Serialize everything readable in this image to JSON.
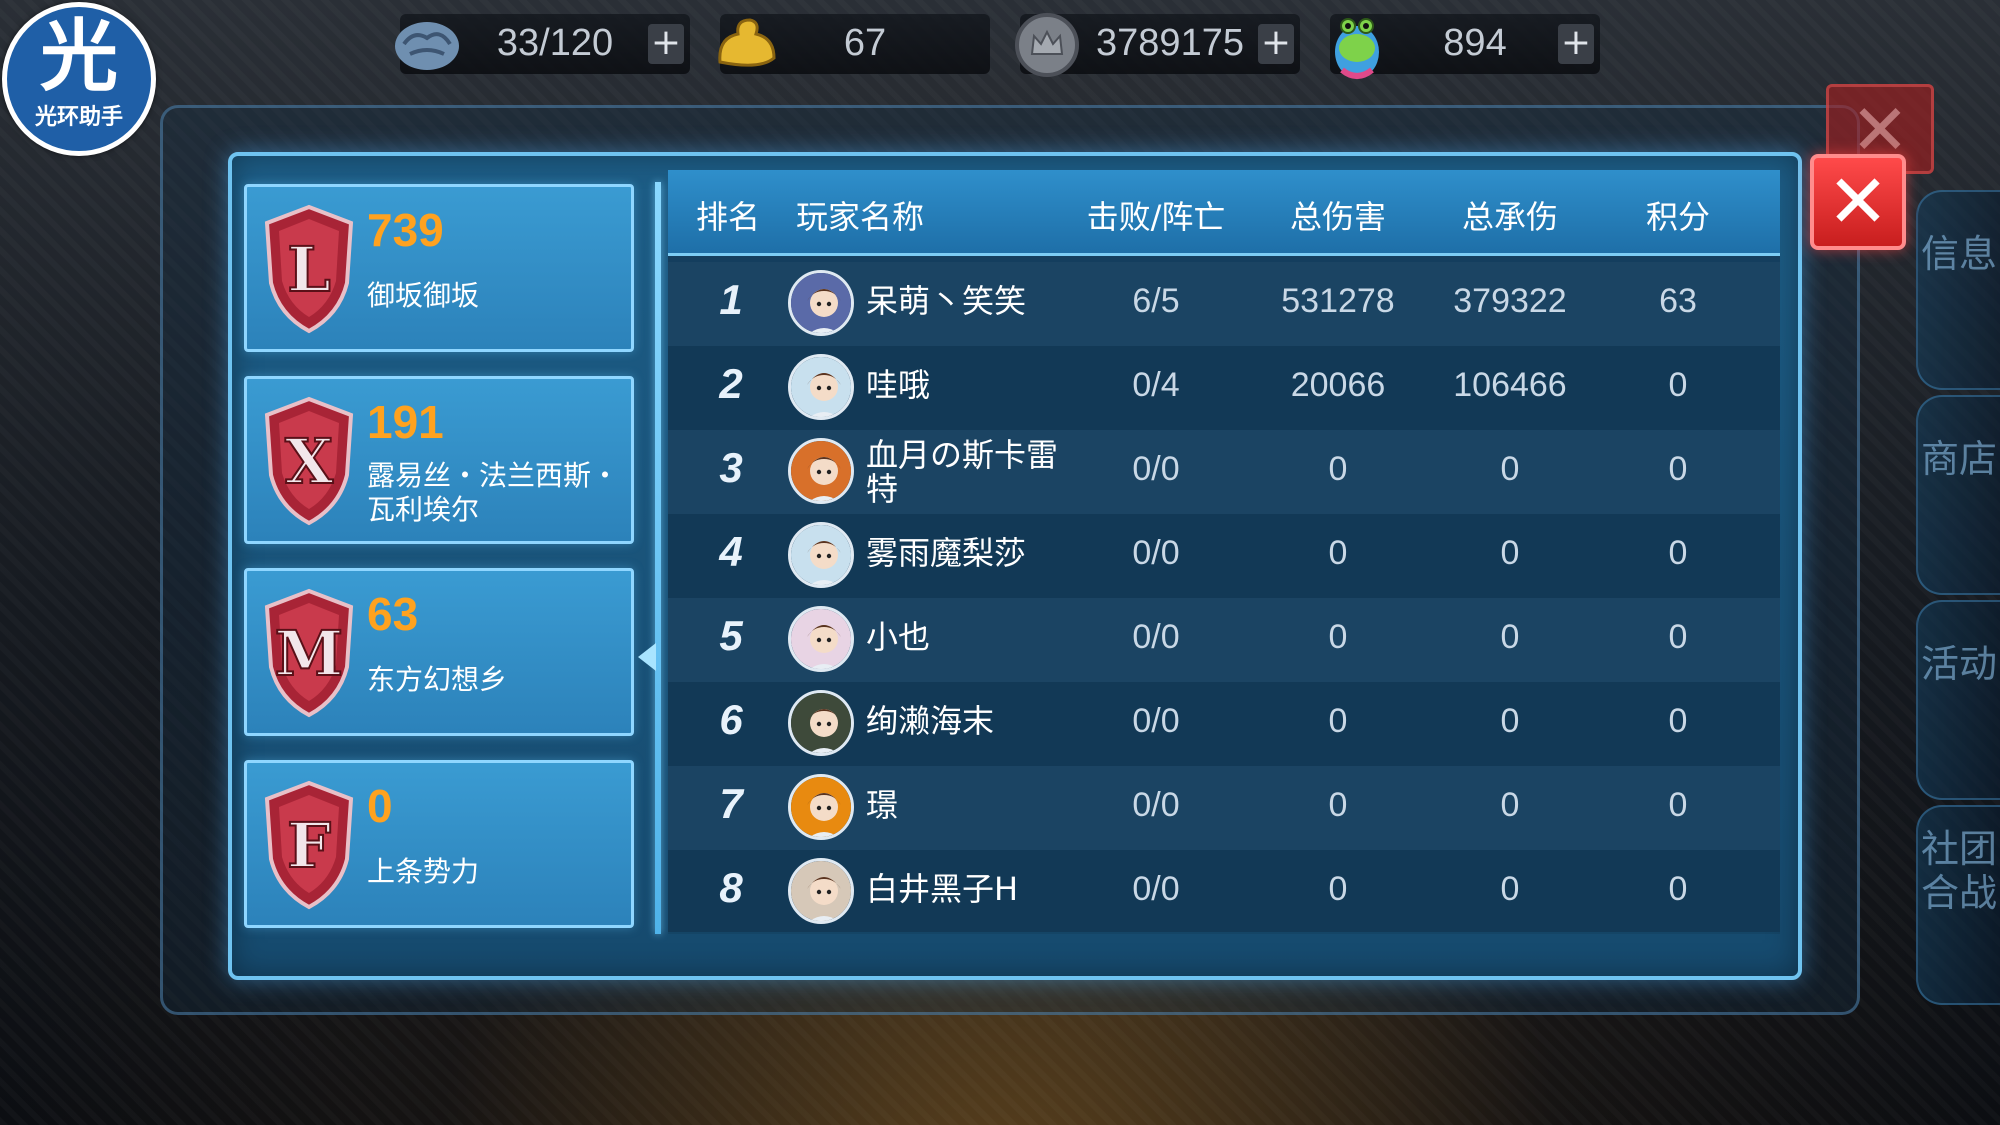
{
  "logo": {
    "glyph": "光",
    "text": "光环助手"
  },
  "resources": [
    {
      "icon": "brain-icon",
      "value": "33/120",
      "plus": "+"
    },
    {
      "icon": "muscle-icon",
      "value": "67"
    },
    {
      "icon": "crown-coin-icon",
      "value": "3789175",
      "plus": "+"
    },
    {
      "icon": "frog-gem-icon",
      "value": "894",
      "plus": "+"
    }
  ],
  "side_tabs": [
    "信息",
    "商店",
    "活动",
    "社团合战"
  ],
  "close_label": "✕",
  "teams": [
    {
      "letter": "L",
      "score": "739",
      "name": "御坂御坂",
      "color": "#b0283a"
    },
    {
      "letter": "X",
      "score": "191",
      "name": "露易丝・法兰西斯・瓦利埃尔",
      "color": "#b0283a"
    },
    {
      "letter": "M",
      "score": "63",
      "name": "东方幻想乡",
      "color": "#b0283a"
    },
    {
      "letter": "F",
      "score": "0",
      "name": "上条势力",
      "color": "#b0283a"
    }
  ],
  "table": {
    "headers": {
      "rank": "排名",
      "player": "玩家名称",
      "kd": "击败/阵亡",
      "damage": "总伤害",
      "taken": "总承伤",
      "points": "积分"
    },
    "rows": [
      {
        "rank": "1",
        "player": "呆萌丶笑笑",
        "kd": "6/5",
        "damage": "531278",
        "taken": "379322",
        "points": "63",
        "avatar_color": "#5a6aa8"
      },
      {
        "rank": "2",
        "player": "哇哦",
        "kd": "0/4",
        "damage": "20066",
        "taken": "106466",
        "points": "0",
        "avatar_color": "#c8e0ee"
      },
      {
        "rank": "3",
        "player": "血月の斯卡雷特",
        "kd": "0/0",
        "damage": "0",
        "taken": "0",
        "points": "0",
        "avatar_color": "#d8702a"
      },
      {
        "rank": "4",
        "player": "雾雨魔梨莎",
        "kd": "0/0",
        "damage": "0",
        "taken": "0",
        "points": "0",
        "avatar_color": "#c8e0ee"
      },
      {
        "rank": "5",
        "player": "小也",
        "kd": "0/0",
        "damage": "0",
        "taken": "0",
        "points": "0",
        "avatar_color": "#e8d4e4"
      },
      {
        "rank": "6",
        "player": "绚濑海末",
        "kd": "0/0",
        "damage": "0",
        "taken": "0",
        "points": "0",
        "avatar_color": "#3e4a3a"
      },
      {
        "rank": "7",
        "player": "璟",
        "kd": "0/0",
        "damage": "0",
        "taken": "0",
        "points": "0",
        "avatar_color": "#e88a10"
      },
      {
        "rank": "8",
        "player": "白井黑子H",
        "kd": "0/0",
        "damage": "0",
        "taken": "0",
        "points": "0",
        "avatar_color": "#d6c8b8"
      }
    ]
  }
}
